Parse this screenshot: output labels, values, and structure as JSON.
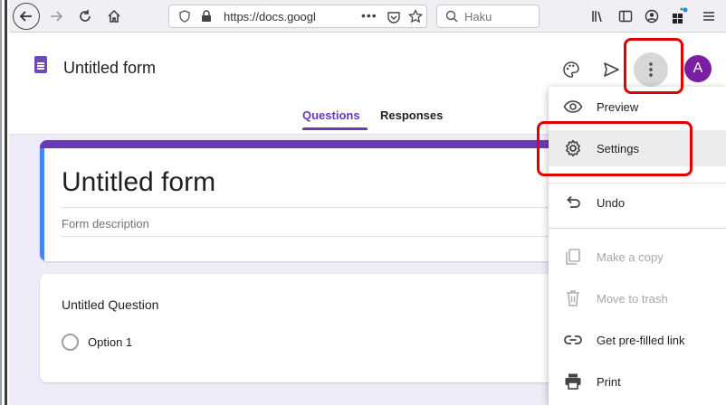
{
  "browser": {
    "url": "https://docs.googl",
    "search_placeholder": "Haku"
  },
  "header": {
    "form_name": "Untitled form",
    "tabs": [
      {
        "label": "Questions",
        "active": true
      },
      {
        "label": "Responses",
        "active": false
      }
    ],
    "avatar_letter": "A",
    "accent_color": "#673ab7"
  },
  "form": {
    "title": "Untitled form",
    "description_placeholder": "Form description",
    "question": {
      "title": "Untitled Question",
      "options": [
        "Option 1"
      ]
    }
  },
  "menu": {
    "items": [
      {
        "label": "Preview",
        "icon": "eye-icon",
        "enabled": true
      },
      {
        "label": "Settings",
        "icon": "gear-icon",
        "enabled": true
      },
      {
        "label": "Undo",
        "icon": "undo-icon",
        "enabled": true
      },
      {
        "label": "Make a copy",
        "icon": "copy-icon",
        "enabled": false
      },
      {
        "label": "Move to trash",
        "icon": "trash-icon",
        "enabled": false
      },
      {
        "label": "Get pre-filled link",
        "icon": "link-icon",
        "enabled": true
      },
      {
        "label": "Print",
        "icon": "printer-icon",
        "enabled": true
      }
    ]
  }
}
